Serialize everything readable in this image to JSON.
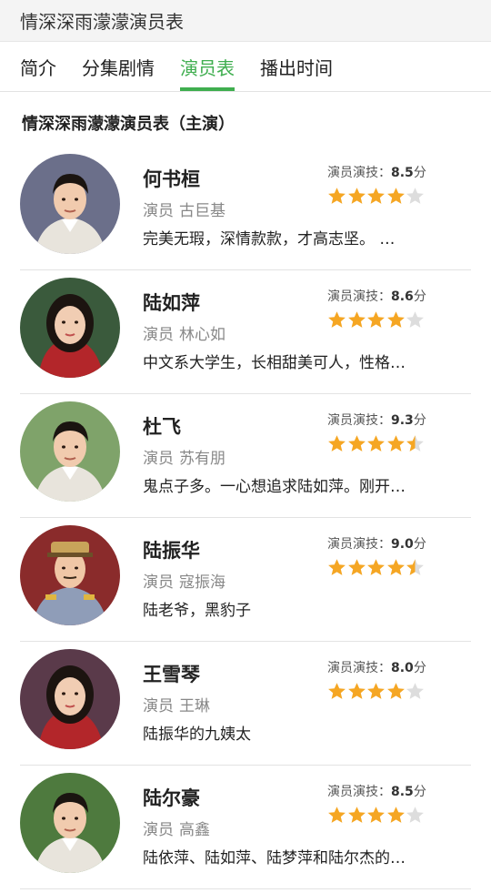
{
  "header": {
    "title": "情深深雨濛濛演员表"
  },
  "tabs": [
    {
      "label": "简介",
      "active": false
    },
    {
      "label": "分集剧情",
      "active": false
    },
    {
      "label": "演员表",
      "active": true
    },
    {
      "label": "播出时间",
      "active": false
    }
  ],
  "section": {
    "title": "情深深雨濛濛演员表（主演）"
  },
  "rating_prefix": "演员演技：",
  "rating_suffix": "分",
  "actor_prefix": "演员",
  "colors": {
    "accent": "#3fae4f",
    "star": "#f5a623",
    "star_empty": "#dddddd"
  },
  "cast": [
    {
      "role": "何书桓",
      "actor": "古巨基",
      "score": "8.5",
      "stars": 4.0,
      "desc": "完美无瑕，深情款款，才高志坚。 …",
      "avatar_icon": "portrait-man-icon"
    },
    {
      "role": "陆如萍",
      "actor": "林心如",
      "score": "8.6",
      "stars": 4.0,
      "desc": "中文系大学生，长相甜美可人，性格…",
      "avatar_icon": "portrait-woman-icon"
    },
    {
      "role": "杜飞",
      "actor": "苏有朋",
      "score": "9.3",
      "stars": 4.5,
      "desc": "鬼点子多。一心想追求陆如萍。刚开…",
      "avatar_icon": "portrait-man-icon"
    },
    {
      "role": "陆振华",
      "actor": "寇振海",
      "score": "9.0",
      "stars": 4.5,
      "desc": "陆老爷，黑豹子",
      "avatar_icon": "portrait-officer-icon"
    },
    {
      "role": "王雪琴",
      "actor": "王琳",
      "score": "8.0",
      "stars": 4.0,
      "desc": "陆振华的九姨太",
      "avatar_icon": "portrait-woman-icon"
    },
    {
      "role": "陆尔豪",
      "actor": "高鑫",
      "score": "8.5",
      "stars": 4.0,
      "desc": "陆依萍、陆如萍、陆梦萍和陆尔杰的…",
      "avatar_icon": "portrait-man-icon"
    }
  ]
}
